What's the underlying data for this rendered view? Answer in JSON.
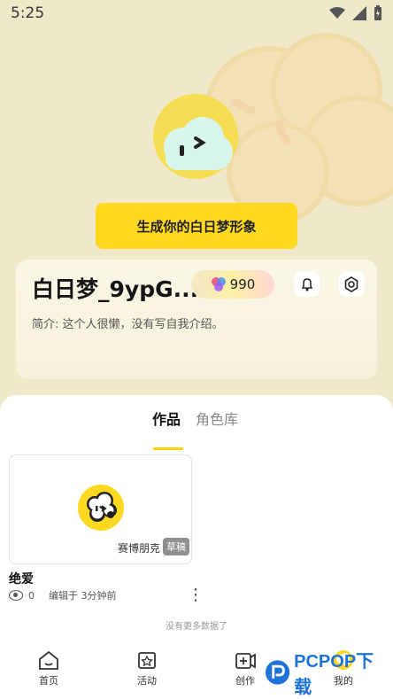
{
  "status_bar": {
    "time": "5:25"
  },
  "profile": {
    "generate_button": "生成你的白日梦形象",
    "username": "白日梦_9ypG...",
    "points": "990",
    "bio": "简介: 这个人很懒，没有写自我介绍。"
  },
  "tabs": [
    {
      "label": "作品",
      "active": true
    },
    {
      "label": "角色库",
      "active": false
    }
  ],
  "work": {
    "author": "赛博朋克",
    "badge": "草稿",
    "title": "绝爱",
    "views": "0",
    "edited": "编辑于 3分钟前"
  },
  "list_end_text": "没有更多数据了",
  "bottom_nav": {
    "items": [
      {
        "label": "首页",
        "icon": "home-icon"
      },
      {
        "label": "活动",
        "icon": "activity-icon"
      },
      {
        "label": "创作",
        "icon": "create-icon"
      },
      {
        "label": "我的",
        "icon": "profile-icon"
      }
    ]
  },
  "watermark": {
    "text": "PCPOP下载"
  },
  "colors": {
    "accent": "#ffd91f",
    "background": "#efe9c9",
    "card": "#f8f3df",
    "brand_watermark": "#1e72d8"
  }
}
